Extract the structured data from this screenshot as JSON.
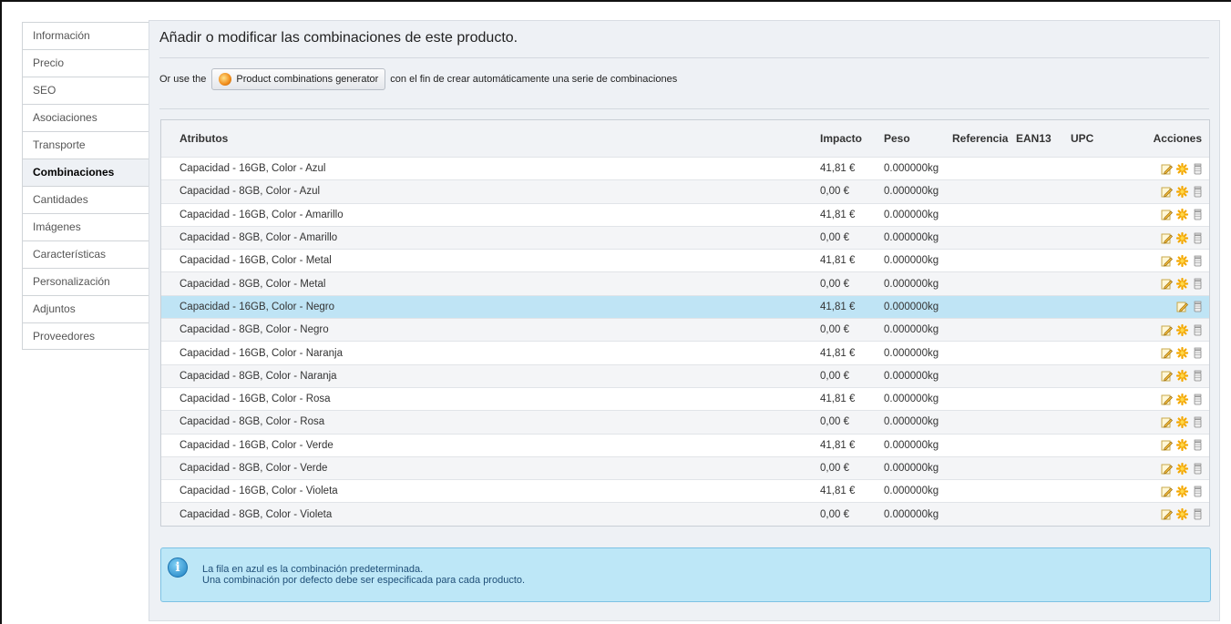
{
  "tabs": [
    {
      "label": "Información",
      "active": false
    },
    {
      "label": "Precio",
      "active": false
    },
    {
      "label": "SEO",
      "active": false
    },
    {
      "label": "Asociaciones",
      "active": false
    },
    {
      "label": "Transporte",
      "active": false
    },
    {
      "label": "Combinaciones",
      "active": true
    },
    {
      "label": "Cantidades",
      "active": false
    },
    {
      "label": "Imágenes",
      "active": false
    },
    {
      "label": "Características",
      "active": false
    },
    {
      "label": "Personalización",
      "active": false
    },
    {
      "label": "Adjuntos",
      "active": false
    },
    {
      "label": "Proveedores",
      "active": false
    }
  ],
  "main": {
    "title": "Añadir o modificar las combinaciones de este producto.",
    "generator": {
      "prefix": "Or use the",
      "button_label": "Product combinations generator",
      "suffix": "con el fin de crear automáticamente una serie de combinaciones"
    }
  },
  "table": {
    "headers": {
      "atributos": "Atributos",
      "impacto": "Impacto",
      "peso": "Peso",
      "referencia": "Referencia",
      "ean13": "EAN13",
      "upc": "UPC",
      "acciones": "Acciones"
    },
    "rows": [
      {
        "atributos": "Capacidad - 16GB, Color - Azul",
        "impacto": "41,81 €",
        "peso": "0.000000kg",
        "referencia": "",
        "ean13": "",
        "upc": "",
        "is_default": false
      },
      {
        "atributos": "Capacidad - 8GB, Color - Azul",
        "impacto": "0,00 €",
        "peso": "0.000000kg",
        "referencia": "",
        "ean13": "",
        "upc": "",
        "is_default": false
      },
      {
        "atributos": "Capacidad - 16GB, Color - Amarillo",
        "impacto": "41,81 €",
        "peso": "0.000000kg",
        "referencia": "",
        "ean13": "",
        "upc": "",
        "is_default": false
      },
      {
        "atributos": "Capacidad - 8GB, Color - Amarillo",
        "impacto": "0,00 €",
        "peso": "0.000000kg",
        "referencia": "",
        "ean13": "",
        "upc": "",
        "is_default": false
      },
      {
        "atributos": "Capacidad - 16GB, Color - Metal",
        "impacto": "41,81 €",
        "peso": "0.000000kg",
        "referencia": "",
        "ean13": "",
        "upc": "",
        "is_default": false
      },
      {
        "atributos": "Capacidad - 8GB, Color - Metal",
        "impacto": "0,00 €",
        "peso": "0.000000kg",
        "referencia": "",
        "ean13": "",
        "upc": "",
        "is_default": false
      },
      {
        "atributos": "Capacidad - 16GB, Color - Negro",
        "impacto": "41,81 €",
        "peso": "0.000000kg",
        "referencia": "",
        "ean13": "",
        "upc": "",
        "is_default": true
      },
      {
        "atributos": "Capacidad - 8GB, Color - Negro",
        "impacto": "0,00 €",
        "peso": "0.000000kg",
        "referencia": "",
        "ean13": "",
        "upc": "",
        "is_default": false
      },
      {
        "atributos": "Capacidad - 16GB, Color - Naranja",
        "impacto": "41,81 €",
        "peso": "0.000000kg",
        "referencia": "",
        "ean13": "",
        "upc": "",
        "is_default": false
      },
      {
        "atributos": "Capacidad - 8GB, Color - Naranja",
        "impacto": "0,00 €",
        "peso": "0.000000kg",
        "referencia": "",
        "ean13": "",
        "upc": "",
        "is_default": false
      },
      {
        "atributos": "Capacidad - 16GB, Color - Rosa",
        "impacto": "41,81 €",
        "peso": "0.000000kg",
        "referencia": "",
        "ean13": "",
        "upc": "",
        "is_default": false
      },
      {
        "atributos": "Capacidad - 8GB, Color - Rosa",
        "impacto": "0,00 €",
        "peso": "0.000000kg",
        "referencia": "",
        "ean13": "",
        "upc": "",
        "is_default": false
      },
      {
        "atributos": "Capacidad - 16GB, Color - Verde",
        "impacto": "41,81 €",
        "peso": "0.000000kg",
        "referencia": "",
        "ean13": "",
        "upc": "",
        "is_default": false
      },
      {
        "atributos": "Capacidad - 8GB, Color - Verde",
        "impacto": "0,00 €",
        "peso": "0.000000kg",
        "referencia": "",
        "ean13": "",
        "upc": "",
        "is_default": false
      },
      {
        "atributos": "Capacidad - 16GB, Color - Violeta",
        "impacto": "41,81 €",
        "peso": "0.000000kg",
        "referencia": "",
        "ean13": "",
        "upc": "",
        "is_default": false
      },
      {
        "atributos": "Capacidad - 8GB, Color - Violeta",
        "impacto": "0,00 €",
        "peso": "0.000000kg",
        "referencia": "",
        "ean13": "",
        "upc": "",
        "is_default": false
      }
    ],
    "action_icons": [
      "edit-icon",
      "set-default-icon",
      "delete-icon"
    ]
  },
  "info": {
    "line1": "La fila en azul es la combinación predeterminada.",
    "line2": "Una combinación por defecto debe ser especificada para cada producto."
  },
  "colors": {
    "panel_bg": "#eef1f5",
    "default_row": "#bfe4f5",
    "info_bg": "#bde7f7"
  }
}
